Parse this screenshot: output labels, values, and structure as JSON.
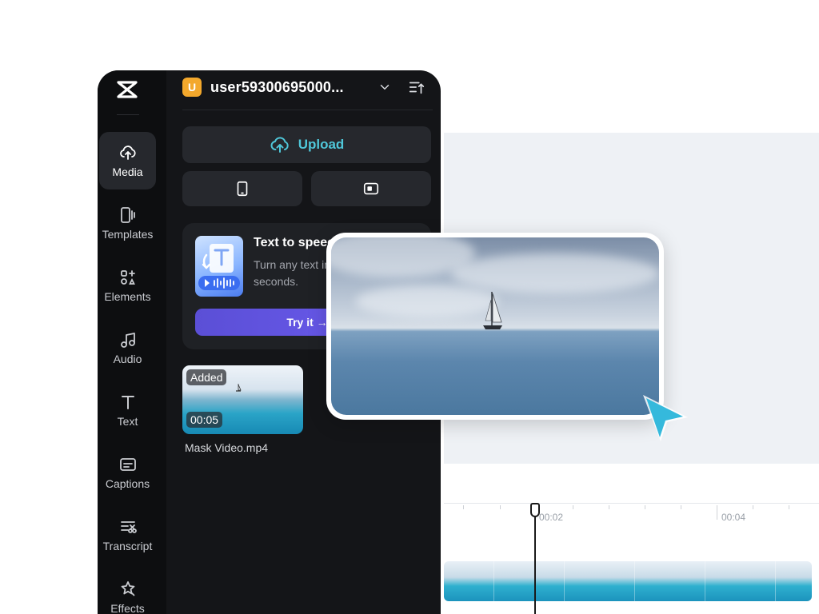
{
  "account": {
    "avatar_letter": "U",
    "username": "user59300695000..."
  },
  "rail": {
    "items": [
      {
        "label": "Media",
        "icon": "cloud-upload-icon"
      },
      {
        "label": "Templates",
        "icon": "templates-icon"
      },
      {
        "label": "Elements",
        "icon": "elements-icon"
      },
      {
        "label": "Audio",
        "icon": "music-note-icon"
      },
      {
        "label": "Text",
        "icon": "text-icon"
      },
      {
        "label": "Captions",
        "icon": "captions-icon"
      },
      {
        "label": "Transcript",
        "icon": "transcript-icon"
      },
      {
        "label": "Effects",
        "icon": "effects-icon"
      }
    ]
  },
  "media_panel": {
    "upload_label": "Upload",
    "tts_card": {
      "title": "Text to speech",
      "description": "Turn any text into speech in seconds.",
      "button_label": "Try it →"
    },
    "media_items": [
      {
        "status": "Added",
        "duration": "00:05",
        "name": "Mask Video.mp4"
      }
    ]
  },
  "timeline": {
    "tick_labels": [
      "00:02",
      "00:04"
    ]
  },
  "colors": {
    "accent": "#4fc6d8",
    "avatar": "#f3a82c",
    "tts_button": "#6c5cf0",
    "panel_bg": "#141518"
  }
}
